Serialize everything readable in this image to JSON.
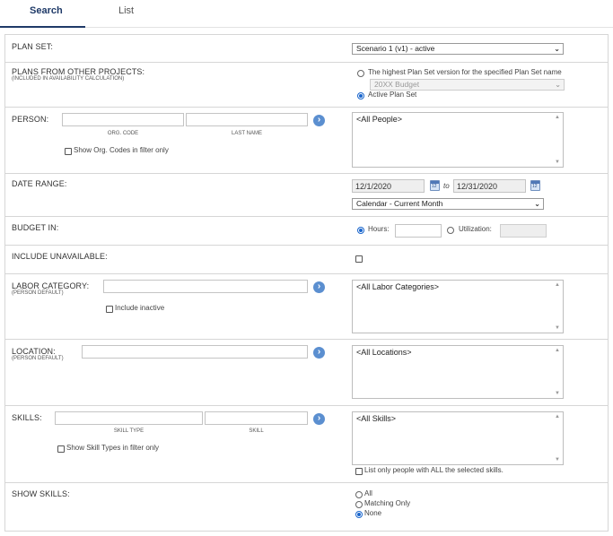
{
  "tabs": {
    "search": "Search",
    "list": "List"
  },
  "plan_set": {
    "label": "PLAN SET:",
    "value": "Scenario 1 (v1) - active"
  },
  "other_projects": {
    "label": "PLANS FROM OTHER PROJECTS:",
    "sublabel": "(INCLUDED IN AVAILABILITY CALCULATION)",
    "option_highest": "The highest Plan Set version for the specified Plan Set name",
    "budget_select": "20XX Budget",
    "option_active": "Active Plan Set"
  },
  "person": {
    "label": "PERSON:",
    "org_code_caption": "ORG. CODE",
    "last_name_caption": "LAST NAME",
    "show_org_codes": "Show Org. Codes in filter only",
    "list_value": "<All People>"
  },
  "date_range": {
    "label": "DATE RANGE:",
    "from": "12/1/2020",
    "to_label": "to",
    "to": "12/31/2020",
    "preset": "Calendar - Current Month",
    "calendar_text": "12"
  },
  "budget_in": {
    "label": "BUDGET IN:",
    "hours": "Hours:",
    "utilization": "Utilization:"
  },
  "include_unavailable": {
    "label": "INCLUDE UNAVAILABLE:"
  },
  "labor_category": {
    "label": "LABOR CATEGORY:",
    "sublabel": "(PERSON DEFAULT)",
    "include_inactive": "Include inactive",
    "list_value": "<All Labor Categories>"
  },
  "location": {
    "label": "LOCATION:",
    "sublabel": "(PERSON DEFAULT)",
    "list_value": "<All Locations>"
  },
  "skills": {
    "label": "SKILLS:",
    "skill_type_caption": "SKILL TYPE",
    "skill_caption": "SKILL",
    "show_skill_types": "Show Skill Types in filter only",
    "list_value": "<All Skills>",
    "list_only_all": "List only people with ALL the selected skills."
  },
  "show_skills": {
    "label": "SHOW SKILLS:",
    "options": [
      "All",
      "Matching Only",
      "None"
    ],
    "selected": "None"
  }
}
